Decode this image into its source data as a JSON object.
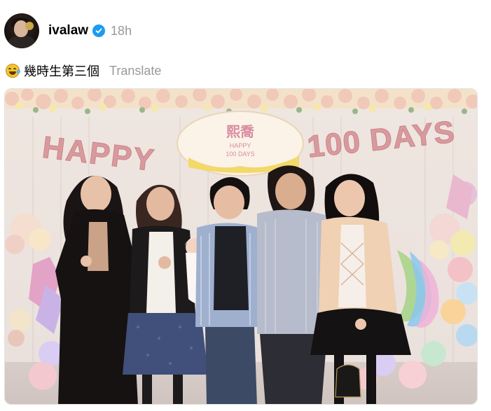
{
  "post": {
    "username": "ivalaw",
    "verified_icon": "verified-badge-icon",
    "timestamp": "18h",
    "caption": "幾時生第三個",
    "caption_emoji": "rolling-on-floor-laughing-emoji",
    "translate_label": "Translate"
  },
  "photo": {
    "banner_left": "HAPPY",
    "banner_right": "100 DAYS",
    "sign_title": "熙喬",
    "sign_line1": "HAPPY",
    "sign_line2": "100 DAYS"
  },
  "colors": {
    "verified_blue": "#1d9bf0",
    "secondary_text": "#999999",
    "balloon_pink": "#d99a9e"
  }
}
